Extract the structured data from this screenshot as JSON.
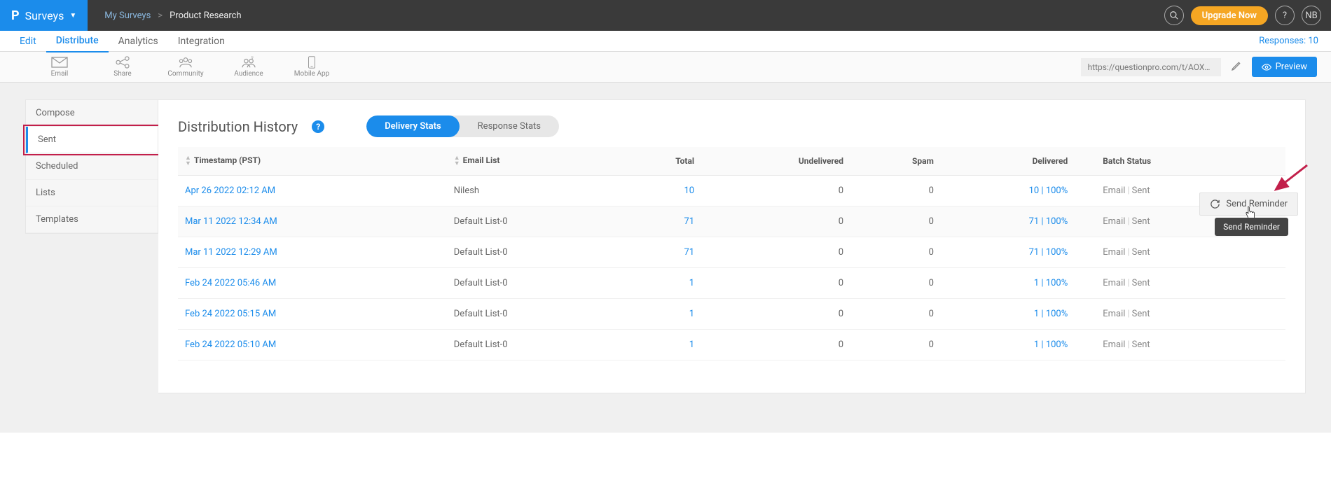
{
  "topbar": {
    "logo_letter": "P",
    "surveys_label": "Surveys",
    "breadcrumb_root": "My Surveys",
    "breadcrumb_sep": ">",
    "breadcrumb_current": "Product Research",
    "upgrade_label": "Upgrade Now",
    "help_label": "?",
    "avatar_initials": "NB"
  },
  "tabs": {
    "items": [
      "Edit",
      "Distribute",
      "Analytics",
      "Integration"
    ],
    "active_index": 1,
    "responses_label": "Responses: 10"
  },
  "toolbar": {
    "items": [
      "Email",
      "Share",
      "Community",
      "Audience",
      "Mobile App"
    ],
    "url": "https://questionpro.com/t/AOXAyZrIjI",
    "preview_label": "Preview"
  },
  "sidebar": {
    "items": [
      "Compose",
      "Sent",
      "Scheduled",
      "Lists",
      "Templates"
    ],
    "active_index": 1
  },
  "main": {
    "title": "Distribution History",
    "pill_tabs": [
      "Delivery Stats",
      "Response Stats"
    ],
    "pill_active": 0,
    "columns": {
      "timestamp": "Timestamp (PST)",
      "email_list": "Email List",
      "total": "Total",
      "undelivered": "Undelivered",
      "spam": "Spam",
      "delivered": "Delivered",
      "batch_status": "Batch Status"
    },
    "status_parts": {
      "type": "Email",
      "state": "Sent"
    },
    "rows": [
      {
        "timestamp": "Apr 26 2022 02:12 AM",
        "list": "Nilesh",
        "total": "10",
        "undelivered": "0",
        "spam": "0",
        "delivered": "10 | 100%"
      },
      {
        "timestamp": "Mar 11 2022 12:34 AM",
        "list": "Default List-0",
        "total": "71",
        "undelivered": "0",
        "spam": "0",
        "delivered": "71 | 100%"
      },
      {
        "timestamp": "Mar 11 2022 12:29 AM",
        "list": "Default List-0",
        "total": "71",
        "undelivered": "0",
        "spam": "0",
        "delivered": "71 | 100%"
      },
      {
        "timestamp": "Feb 24 2022 05:46 AM",
        "list": "Default List-0",
        "total": "1",
        "undelivered": "0",
        "spam": "0",
        "delivered": "1 | 100%"
      },
      {
        "timestamp": "Feb 24 2022 05:15 AM",
        "list": "Default List-0",
        "total": "1",
        "undelivered": "0",
        "spam": "0",
        "delivered": "1 | 100%"
      },
      {
        "timestamp": "Feb 24 2022 05:10 AM",
        "list": "Default List-0",
        "total": "1",
        "undelivered": "0",
        "spam": "0",
        "delivered": "1 | 100%"
      }
    ],
    "hovered_row_index": 1,
    "reminder_button_label": "Send Reminder",
    "reminder_tooltip": "Send Reminder"
  }
}
